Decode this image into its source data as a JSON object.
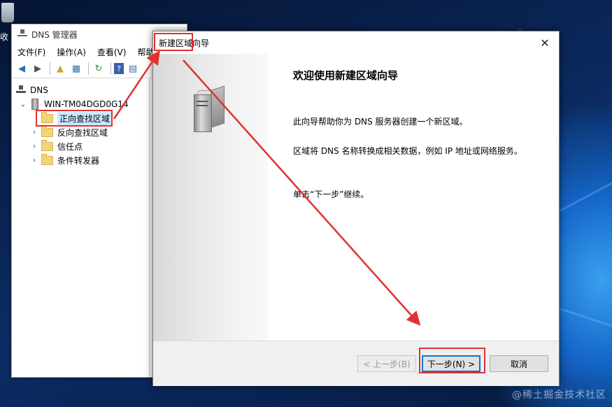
{
  "desktop": {
    "recycle_label": "收",
    "watermark": "@稀土掘金技术社区"
  },
  "dns_manager": {
    "title": "DNS 管理器",
    "menu": [
      "文件(F)",
      "操作(A)",
      "查看(V)",
      "帮助"
    ],
    "tree": {
      "root": "DNS",
      "server": "WIN-TM04DGD0G14",
      "zones": [
        "正向查找区域",
        "反向查找区域",
        "信任点",
        "条件转发器"
      ]
    }
  },
  "wizard": {
    "title": "新建区域向导",
    "heading": "欢迎使用新建区域向导",
    "para1": "此向导帮助你为 DNS 服务器创建一个新区域。",
    "para2": "区域将 DNS 名称转换成相关数据，例如 IP 地址或网络服务。",
    "para3": "单击“下一步”继续。",
    "back_label": "< 上一步(B)",
    "next_label": "下一步(N) >",
    "cancel_label": "取消",
    "close_glyph": "✕"
  },
  "colors": {
    "annotation": "#e03131",
    "selection": "#cce8ff",
    "focus_blue": "#0078d7"
  }
}
